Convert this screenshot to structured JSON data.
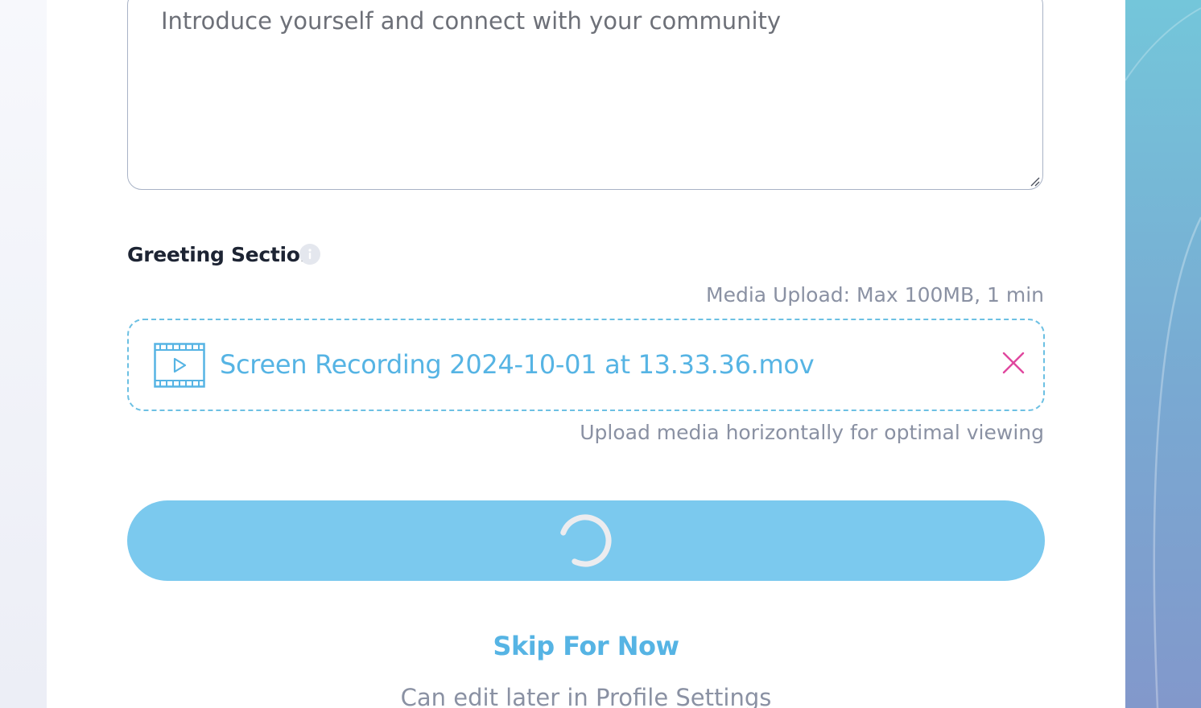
{
  "bio": {
    "placeholder": "Introduce yourself and connect with your community"
  },
  "greeting": {
    "label": "Greeting Section",
    "info_icon": "info-icon",
    "media_limit": "Media Upload: Max 100MB, 1 min",
    "file": {
      "icon": "video-file-icon",
      "name": "Screen Recording 2024-10-01 at 13.33.36.mov",
      "remove_icon": "close-icon"
    },
    "hint": "Upload media horizontally for optimal viewing"
  },
  "actions": {
    "submit_state": "loading",
    "spinner_icon": "loading-spinner-icon",
    "skip_label": "Skip For Now",
    "edit_later": "Can edit later in Profile Settings"
  },
  "colors": {
    "accent": "#56b4e4",
    "button": "#7bc9ee",
    "remove": "#e0479e",
    "muted_text": "#8a91a3",
    "heading": "#1d2433"
  }
}
